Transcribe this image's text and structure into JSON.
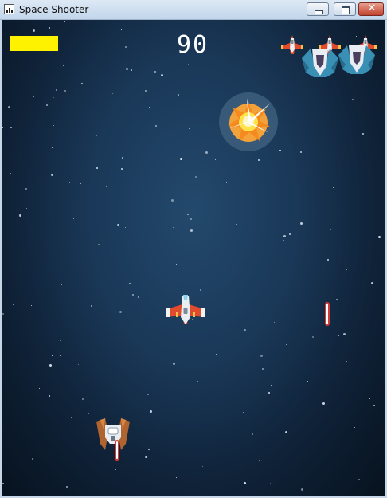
{
  "window": {
    "title": "Space Shooter",
    "controls": {
      "minimize": "minimize",
      "maximize": "maximize",
      "close": "✕"
    }
  },
  "hud": {
    "score": "90",
    "health_fraction": 1.0,
    "health_color": "#fff200"
  },
  "colors": {
    "background_center": "#23496c",
    "background_edge": "#07121e",
    "laser_outline": "#d33a35",
    "ship_red": "#e04a2d",
    "enemy_blue": "#3a8fb5",
    "enemy_brown": "#b0642f"
  },
  "sprites": {
    "player_ship": "player-ship-icon",
    "enemy_small": "red-fighter-icon",
    "enemy_large": "blue-cruiser-icon",
    "enemy_brown": "brown-fighter-icon",
    "explosion": "explosion-icon",
    "laser": "laser-icon"
  }
}
